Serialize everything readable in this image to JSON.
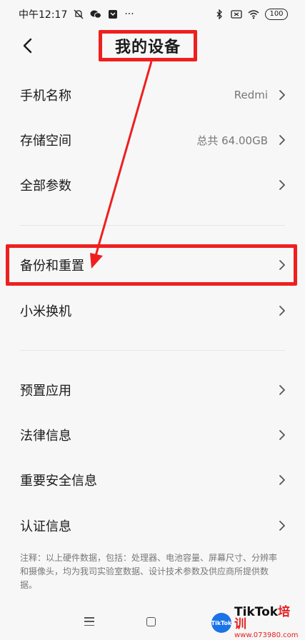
{
  "status_bar": {
    "time": "中午12:17",
    "more": "···",
    "battery": "100"
  },
  "header": {
    "title": "我的设备"
  },
  "items": [
    {
      "label": "手机名称",
      "value": "Redmi"
    },
    {
      "label": "存储空间",
      "value": "总共 64.00GB"
    },
    {
      "label": "全部参数",
      "value": ""
    },
    {
      "label": "备份和重置",
      "value": ""
    },
    {
      "label": "小米换机",
      "value": ""
    },
    {
      "label": "预置应用",
      "value": ""
    },
    {
      "label": "法律信息",
      "value": ""
    },
    {
      "label": "重要安全信息",
      "value": ""
    },
    {
      "label": "认证信息",
      "value": ""
    }
  ],
  "note": "注释：以上硬件数据，包括：处理器、电池容量、屏幕尺寸、分辨率和摄像头，均为我司实验室数据、设计技术参数及供应商所提供数据。",
  "watermark": {
    "logo": "TikTok",
    "brand_a": "TikTok",
    "brand_b": "培训",
    "site": "www.073980.com"
  },
  "colors": {
    "annotation_red": "#ef1f1f",
    "background": "#f7f7f7",
    "secondary_text": "#777777"
  }
}
